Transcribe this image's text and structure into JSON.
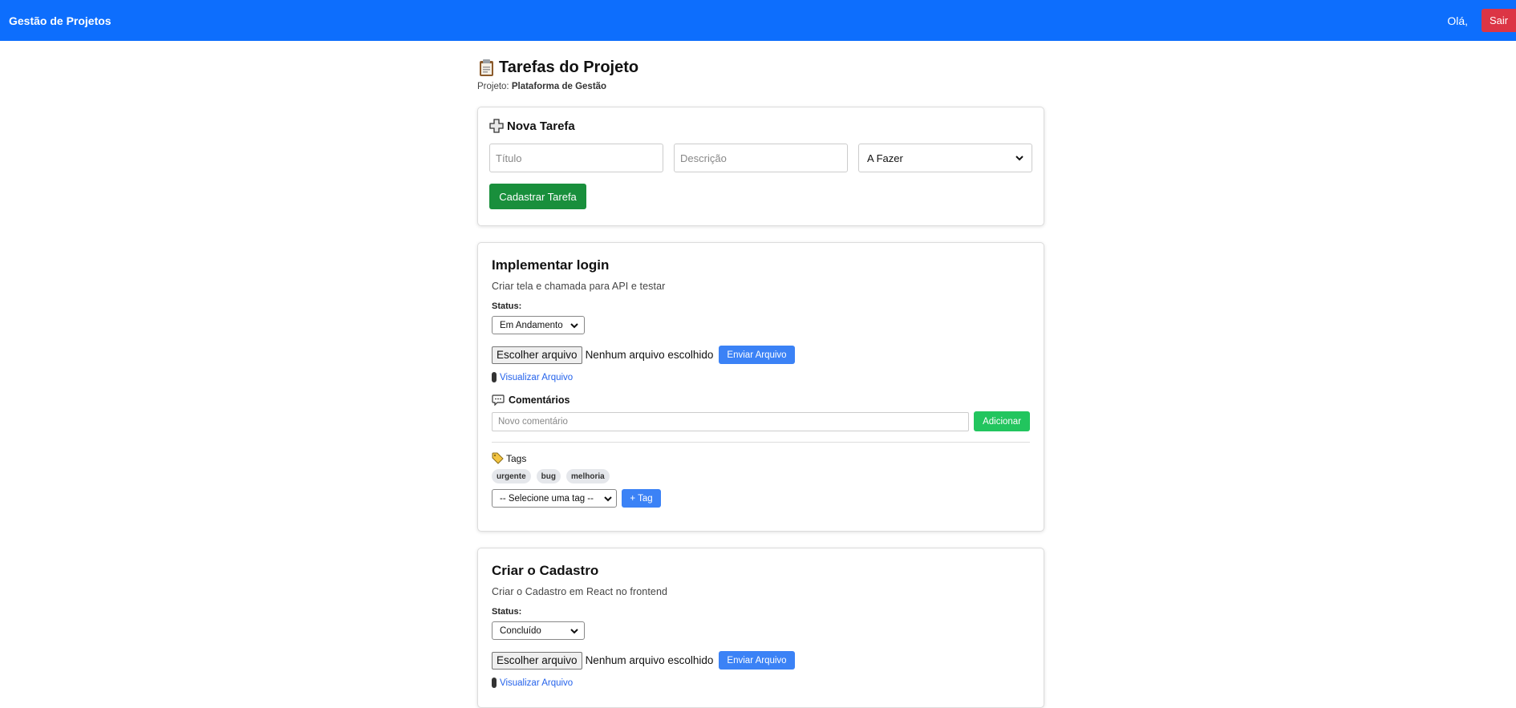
{
  "navbar": {
    "brand": "Gestão de Projetos",
    "greeting": "Olá,",
    "logout_label": "Sair"
  },
  "page": {
    "title": "Tarefas do Projeto",
    "project_prefix": "Projeto:",
    "project_name": "Plataforma de Gestão"
  },
  "new_task": {
    "heading": "Nova Tarefa",
    "title_placeholder": "Título",
    "description_placeholder": "Descrição",
    "status_selected": "A Fazer",
    "submit_label": "Cadastrar Tarefa"
  },
  "tasks": [
    {
      "title": "Implementar login",
      "description": "Criar tela e chamada para API e testar",
      "status_label": "Status:",
      "status": "Em Andamento",
      "file_button": "Escolher arquivo",
      "file_status": "Nenhum arquivo escolhido",
      "upload_label": "Enviar Arquivo",
      "view_file_label": "Visualizar Arquivo",
      "comments_heading": "Comentários",
      "comment_placeholder": "Novo comentário",
      "add_comment_label": "Adicionar",
      "tags_heading": "Tags",
      "tags": [
        "urgente",
        "bug",
        "melhoria"
      ],
      "tag_select": "-- Selecione uma tag --",
      "add_tag_label": "+ Tag"
    },
    {
      "title": "Criar o Cadastro",
      "description": "Criar o Cadastro em React no frontend",
      "status_label": "Status:",
      "status": "Concluído",
      "file_button": "Escolher arquivo",
      "file_status": "Nenhum arquivo escolhido",
      "upload_label": "Enviar Arquivo",
      "view_file_label": "Visualizar Arquivo"
    }
  ],
  "icons": {
    "page_title": "clipboard-icon",
    "new_task": "plus-icon",
    "comments": "speech-bubble-icon",
    "tags": "tag-icon",
    "file": "paperclip-icon"
  },
  "colors": {
    "primary": "#0d6efd",
    "danger": "#dc3545",
    "success": "#198f3c",
    "accent_blue": "#3b82f6",
    "accent_green": "#22c55e"
  }
}
